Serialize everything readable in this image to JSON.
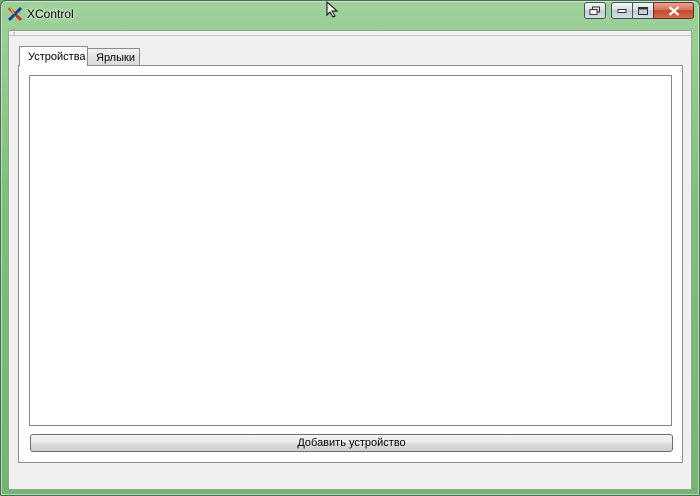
{
  "window": {
    "title": "XControl",
    "icon": "xcontrol-app-icon",
    "caption_buttons": [
      "restore-down-icon",
      "minimize-icon",
      "maximize-icon",
      "close-icon"
    ]
  },
  "tabs": [
    {
      "label": "Устройства",
      "active": true
    },
    {
      "label": "Ярлыки",
      "active": false
    }
  ],
  "devices_list": {
    "items": []
  },
  "actions": {
    "add_device_label": "Добавить устройство"
  },
  "colors": {
    "desktop_accent": "#6db36a",
    "close_button": "#c04a30"
  }
}
